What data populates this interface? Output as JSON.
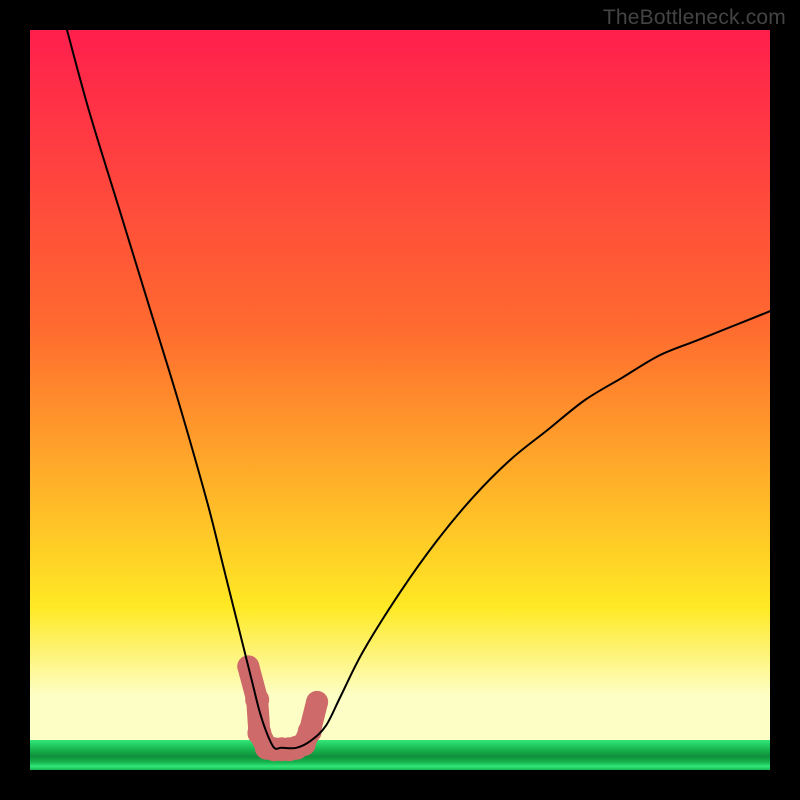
{
  "watermark": "TheBottleneck.com",
  "colors": {
    "frame": "#000000",
    "curve": "#000000",
    "marker": "#cf6a6a",
    "gradient_top": "#ff1f4d",
    "gradient_mid_orange": "#ff6a2f",
    "gradient_mid_yellow": "#ffe924",
    "gradient_lightband": "#fdfec5",
    "gradient_green_dark": "#0f8f3b",
    "gradient_green_mid": "#17b850",
    "gradient_green_light": "#32e77a"
  },
  "chart_data": {
    "type": "line",
    "title": "",
    "xlabel": "",
    "ylabel": "",
    "x_range": [
      0,
      100
    ],
    "y_range": [
      0,
      100
    ],
    "curve": {
      "x": [
        5,
        8,
        12,
        16,
        20,
        24,
        26,
        28,
        30,
        31,
        32,
        33,
        34,
        36,
        38,
        40,
        42,
        45,
        50,
        55,
        60,
        65,
        70,
        75,
        80,
        85,
        90,
        95,
        100
      ],
      "y": [
        100,
        89,
        76,
        63,
        50,
        36,
        28,
        20,
        12,
        8,
        5,
        3,
        3,
        3,
        4,
        6,
        10,
        16,
        24,
        31,
        37,
        42,
        46,
        50,
        53,
        56,
        58,
        60,
        62
      ]
    },
    "markers": {
      "x": [
        29.5,
        30.7,
        31.0,
        32.0,
        33.0,
        34.0,
        35.0,
        36.0,
        37.0,
        37.8,
        38.8
      ],
      "y": [
        14.0,
        9.5,
        5.0,
        3.0,
        2.8,
        2.8,
        2.8,
        3.0,
        3.5,
        5.2,
        9.2
      ]
    },
    "efficiency_band": {
      "y_top": 10,
      "y_bottom": 0
    },
    "green_zone": {
      "y_top": 4,
      "y_bottom": 0
    }
  }
}
